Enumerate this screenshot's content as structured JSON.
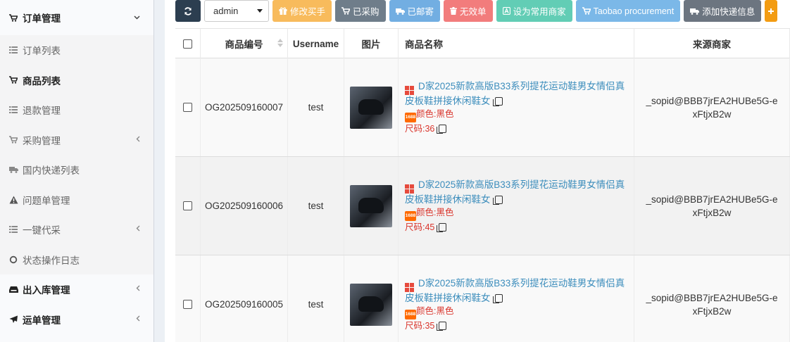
{
  "sidebar": {
    "items": [
      {
        "label": "订单管理",
        "icon": "cart-icon",
        "type": "top",
        "chevron": "down"
      },
      {
        "label": "订单列表",
        "icon": "list-icon",
        "type": "sub"
      },
      {
        "label": "商品列表",
        "icon": "cart-icon",
        "type": "sub-active"
      },
      {
        "label": "退款管理",
        "icon": "list-icon",
        "type": "sub"
      },
      {
        "label": "采购管理",
        "icon": "cart-icon",
        "type": "sub",
        "chevron": "left"
      },
      {
        "label": "国内快递列表",
        "icon": "truck-icon",
        "type": "sub"
      },
      {
        "label": "问题单管理",
        "icon": "warning-icon",
        "type": "sub"
      },
      {
        "label": "一键代采",
        "icon": "list-icon",
        "type": "sub",
        "chevron": "left"
      },
      {
        "label": "状态操作日志",
        "icon": "circle-icon",
        "type": "sub"
      },
      {
        "label": "出入库管理",
        "icon": "inbox-icon",
        "type": "top",
        "chevron": "left"
      },
      {
        "label": "运单管理",
        "icon": "plane-icon",
        "type": "top",
        "chevron": "left"
      }
    ]
  },
  "toolbar": {
    "select_value": "admin",
    "buttons": [
      {
        "label": "修改买手",
        "icon": "gift-icon",
        "color": "#f8bb5c"
      },
      {
        "label": "已采购",
        "icon": "cart-icon",
        "color": "#6f7d8a"
      },
      {
        "label": "已邮寄",
        "icon": "truck-icon",
        "color": "#72aee2"
      },
      {
        "label": "无效单",
        "icon": "trash-icon",
        "color": "#f27c7c"
      },
      {
        "label": "设为常用商家",
        "icon": "font-icon",
        "color": "#62cdb5"
      },
      {
        "label": "Taobao procurement",
        "icon": "cart-icon",
        "color": "#7bb8e8"
      },
      {
        "label": "添加快递信息",
        "icon": "truck-icon",
        "color": "#6c7580"
      }
    ]
  },
  "table": {
    "headers": [
      "商品编号",
      "Username",
      "图片",
      "商品名称",
      "来源商家"
    ],
    "rows": [
      {
        "code": "OG202509160007",
        "username": "test",
        "title": "D家2025新款高版B33系列提花运动鞋男女情侣真皮板鞋拼接休闲鞋女",
        "color": "颜色:黑色",
        "size": "尺码:36",
        "merchant": "_sopid@BBB7jrEA2HUBe5G-exFtjxB2w"
      },
      {
        "code": "OG202509160006",
        "username": "test",
        "title": "D家2025新款高版B33系列提花运动鞋男女情侣真皮板鞋拼接休闲鞋女",
        "color": "颜色:黑色",
        "size": "尺码:45",
        "merchant": "_sopid@BBB7jrEA2HUBe5G-exFtjxB2w"
      },
      {
        "code": "OG202509160005",
        "username": "test",
        "title": "D家2025新款高版B33系列提花运动鞋男女情侣真皮板鞋拼接休闲鞋女",
        "color": "颜色:黑色",
        "size": "尺码:35",
        "merchant": "_sopid@BBB7jrEA2HUBe5G-exFtjxB2w"
      }
    ]
  },
  "badge_1688": "1688"
}
